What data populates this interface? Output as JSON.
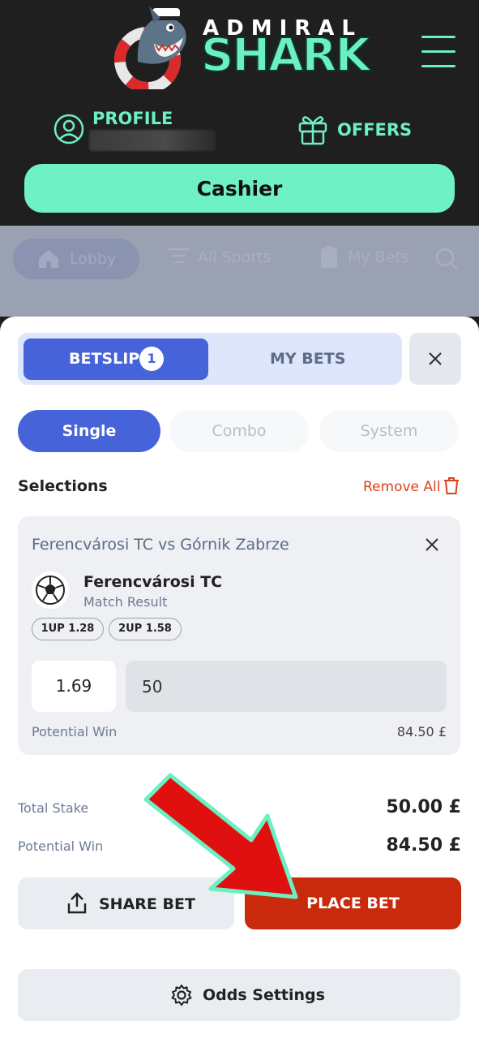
{
  "header": {
    "logo_top": "ADMIRAL",
    "logo_main": "SHARK",
    "profile_label": "PROFILE",
    "offers_label": "OFFERS",
    "cashier_label": "Cashier"
  },
  "nav": {
    "lobby": "Lobby",
    "all_sports": "All Sports",
    "my_bets": "My Bets"
  },
  "betslip": {
    "tab_betslip": "BETSLIP",
    "badge_count": "1",
    "tab_mybets": "MY BETS",
    "modes": {
      "single": "Single",
      "combo": "Combo",
      "system": "System"
    },
    "selections_title": "Selections",
    "remove_all": "Remove All",
    "selection": {
      "match": "Ferencvárosi TC vs Górnik Zabrze",
      "team": "Ferencvárosi TC",
      "market": "Match Result",
      "pill_1": "1UP 1.28",
      "pill_2": "2UP 1.58",
      "odds": "1.69",
      "stake": "50",
      "potential_win_label": "Potential Win",
      "potential_win_value": "84.50 £"
    },
    "total_stake_label": "Total Stake",
    "total_stake_value": "50.00 £",
    "total_win_label": "Potential Win",
    "total_win_value": "84.50 £",
    "share_label": "SHARE BET",
    "place_label": "PLACE BET",
    "odds_settings_label": "Odds Settings"
  },
  "colors": {
    "accent_mint": "#6ef1c4",
    "primary_blue": "#4763da",
    "place_red": "#c92a0c",
    "remove_red": "#d8421e",
    "header_bg": "#1f1f1f"
  },
  "icons": [
    "shark-mascot",
    "menu-icon",
    "user-icon",
    "gift-icon",
    "home-icon",
    "filter-icon",
    "clipboard-icon",
    "search-icon",
    "close-icon",
    "trash-icon",
    "soccer-ball-icon",
    "share-icon",
    "gear-icon",
    "annotation-arrow"
  ]
}
